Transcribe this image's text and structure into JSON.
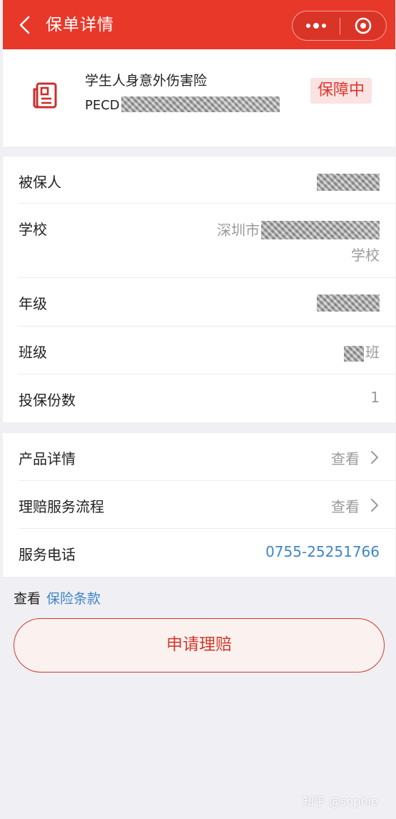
{
  "header": {
    "title": "保单详情",
    "accent": "#e8382a"
  },
  "policy": {
    "name": "学生人身意外伤害险",
    "number_prefix": "PECD",
    "status": "保障中",
    "icon": "document-icon"
  },
  "info": {
    "insured_label": "被保人",
    "school_label": "学校",
    "school_prefix": "深圳市",
    "school_suffix": "学校",
    "grade_label": "年级",
    "class_label": "班级",
    "class_suffix": "班",
    "copies_label": "投保份数",
    "copies_value": "1"
  },
  "actions": {
    "product_label": "产品详情",
    "product_link": "查看",
    "claim_process_label": "理赔服务流程",
    "claim_process_link": "查看",
    "phone_label": "服务电话",
    "phone_value": "0755-25251766"
  },
  "terms": {
    "prefix": "查看",
    "link": "保险条款"
  },
  "claim_button": "申请理赔",
  "watermark": "知乎 @sophie"
}
